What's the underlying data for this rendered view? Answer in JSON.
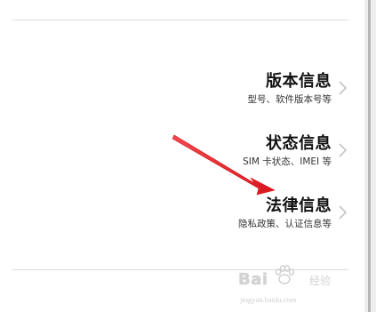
{
  "settings": {
    "items": [
      {
        "title": "版本信息",
        "subtitle": "型号、软件版本号等"
      },
      {
        "title": "状态信息",
        "subtitle": "SIM 卡状态、IMEI 等"
      },
      {
        "title": "法律信息",
        "subtitle": "隐私政策、认证信息等"
      }
    ]
  },
  "watermark": {
    "brand": "Bai",
    "label": "经验",
    "url": "jingyan.baidu.com"
  },
  "colors": {
    "annotation_arrow": "#e8232a",
    "chevron": "#c4c4c4",
    "divider": "#dcdcdc"
  },
  "icons": {
    "row_chevron": "chevron-right-icon",
    "watermark_logo": "paw-icon"
  }
}
